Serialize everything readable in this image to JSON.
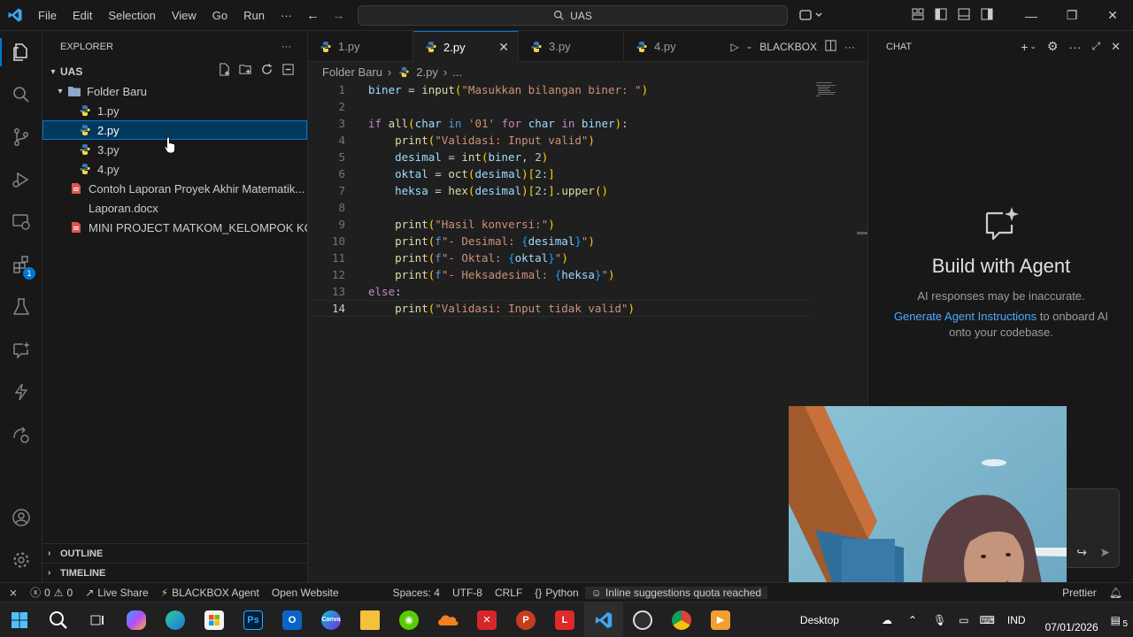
{
  "titlebar": {
    "menu": [
      "File",
      "Edit",
      "Selection",
      "View",
      "Go",
      "Run",
      "···"
    ],
    "search": "UAS"
  },
  "explorer": {
    "header": "EXPLORER",
    "workspace": "UAS",
    "folder": "Folder Baru",
    "files": [
      "1.py",
      "2.py",
      "3.py",
      "4.py"
    ],
    "docs": [
      {
        "name": "Contoh Laporan Proyek Akhir Matematik...",
        "type": "pdf"
      },
      {
        "name": "Laporan.docx",
        "type": "docx"
      },
      {
        "name": "MINI PROJECT MATKOM_KELOMPOK KO...",
        "type": "pdf"
      }
    ],
    "outline": "OUTLINE",
    "timeline": "TIMELINE"
  },
  "editor": {
    "tabs": [
      "1.py",
      "2.py",
      "3.py",
      "4.py"
    ],
    "active_tab": "2.py",
    "blackbox": "BLACKBOX",
    "breadcrumb": {
      "folder": "Folder Baru",
      "file": "2.py",
      "more": "..."
    },
    "line_numbers": [
      "1",
      "2",
      "3",
      "4",
      "5",
      "6",
      "7",
      "8",
      "9",
      "10",
      "11",
      "12",
      "13",
      "14"
    ]
  },
  "chat": {
    "header": "CHAT",
    "title": "Build with Agent",
    "subtitle": "AI responses may be inaccurate.",
    "link": "Generate Agent Instructions",
    "link_suffix_1": " to onboard AI",
    "link_suffix_2": "onto your codebase."
  },
  "statusbar": {
    "errors": "0",
    "warnings": "0",
    "live_share": "Live Share",
    "blackbox_agent": "BLACKBOX Agent",
    "open_website": "Open Website",
    "spaces": "Spaces: 4",
    "encoding": "UTF-8",
    "eol": "CRLF",
    "language": "Python",
    "quota": "Inline suggestions quota reached",
    "prettier": "Prettier"
  },
  "taskbar": {
    "desktop": "Desktop",
    "lang": "IND",
    "date": "07/01/2026",
    "notif_count": "5"
  },
  "colors": {
    "accent": "#0078d4",
    "selection": "#04395e",
    "keyword": "#c586c0",
    "string": "#ce9178",
    "variable": "#9cdcfe",
    "function": "#dcdcaa"
  }
}
